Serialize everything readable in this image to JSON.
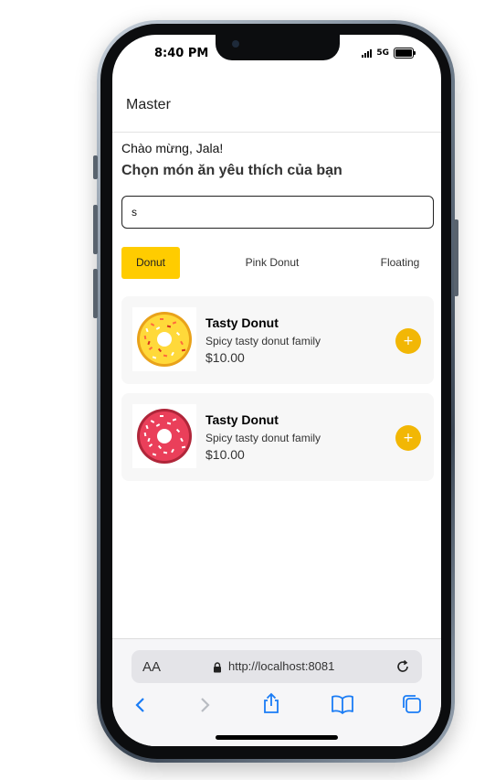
{
  "status_bar": {
    "time": "8:40 PM",
    "network": "5G"
  },
  "app": {
    "title": "Master",
    "greeting": "Chào mừng, Jala!",
    "subtitle": "Chọn món ăn yêu thích của bạn",
    "search": {
      "value": "s"
    },
    "tabs": [
      {
        "label": "Donut",
        "active": true
      },
      {
        "label": "Pink Donut",
        "active": false
      },
      {
        "label": "Floating",
        "active": false
      }
    ],
    "products": [
      {
        "name": "Tasty Donut",
        "description": "Spicy tasty donut family",
        "price": "$10.00",
        "image": "yellow-sprinkled-donut",
        "add_label": "+"
      },
      {
        "name": "Tasty Donut",
        "description": "Spicy tasty donut family",
        "price": "$10.00",
        "image": "pink-sprinkled-donut",
        "add_label": "+"
      }
    ]
  },
  "browser": {
    "text_size_label": "AA",
    "url": "http://localhost:8081",
    "toolbar_icons": [
      "back-icon",
      "forward-icon",
      "share-icon",
      "bookmarks-icon",
      "tabs-icon"
    ]
  },
  "colors": {
    "accent": "#ffcc00",
    "add_button": "#f2b705",
    "card_background": "#f7f7f7",
    "link_blue": "#1a7cf5"
  }
}
